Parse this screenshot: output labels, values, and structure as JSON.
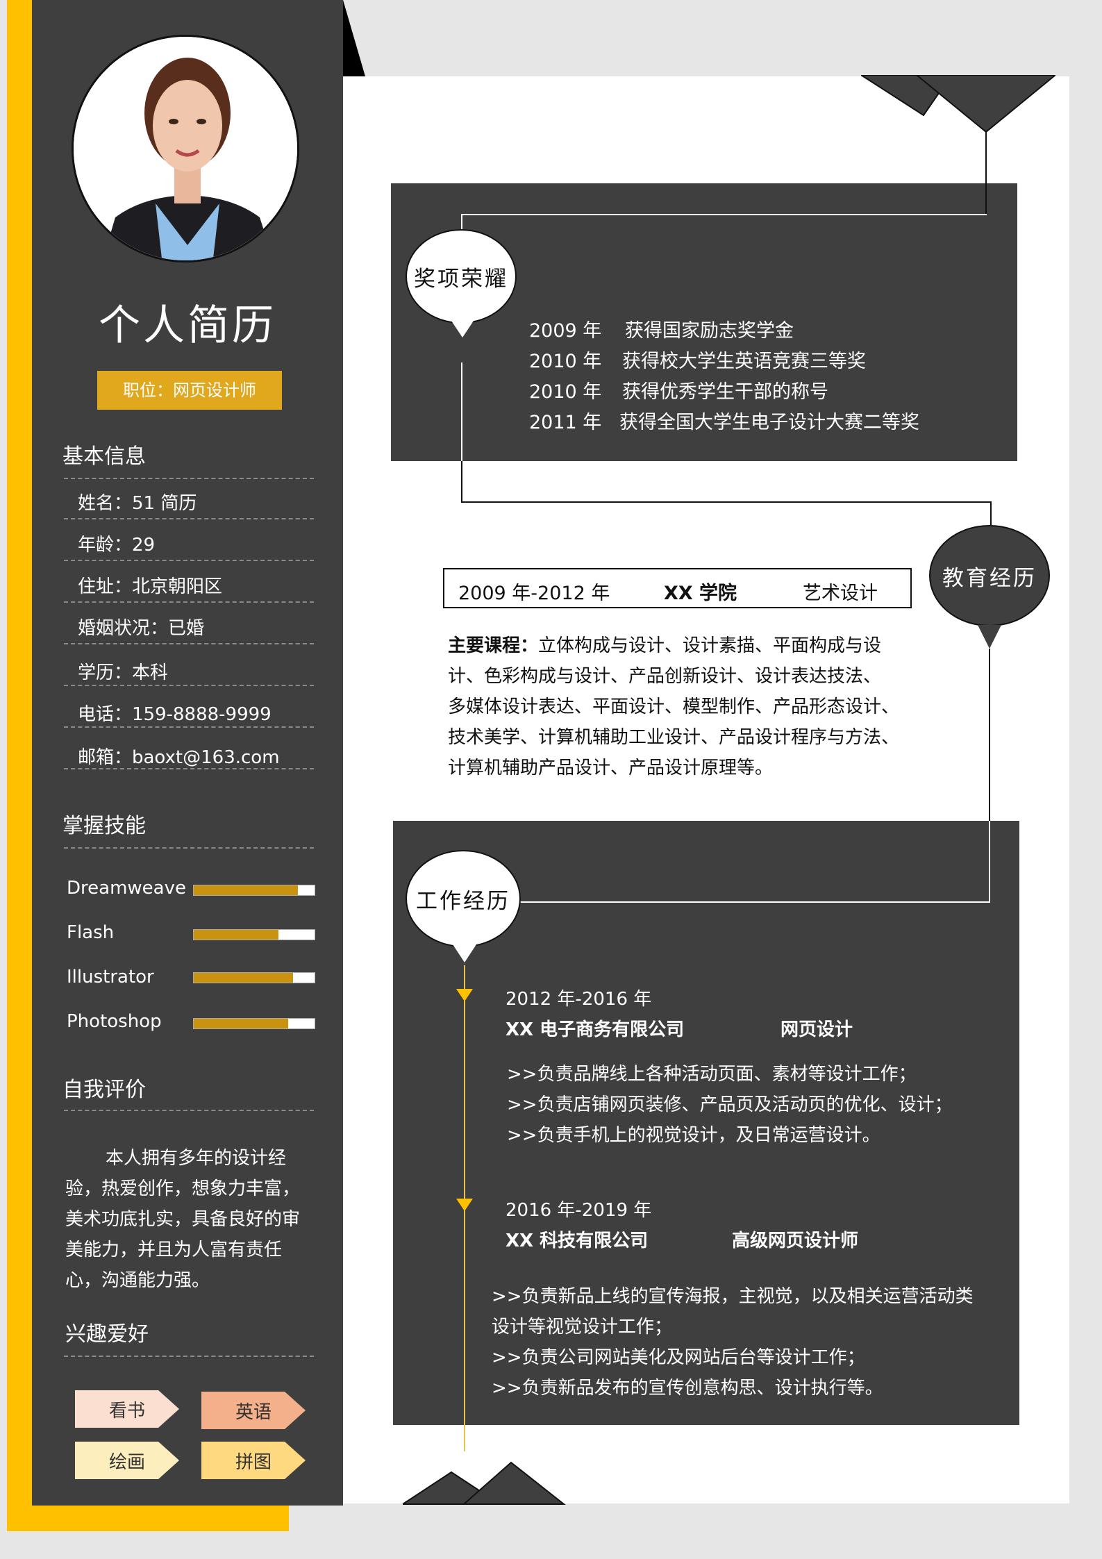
{
  "header": {
    "title": "个人简历",
    "position": "职位：网页设计师"
  },
  "basic_info": {
    "heading": "基本信息",
    "rows": [
      "姓名：51 简历",
      "年龄：29",
      "住址：北京朝阳区",
      "婚姻状况：已婚",
      "学历：本科",
      "电话：159-8888-9999",
      "邮箱：baoxt@163.com"
    ]
  },
  "skills": {
    "heading": "掌握技能",
    "items": [
      {
        "name": "Dreamweave",
        "level": 0.86
      },
      {
        "name": "Flash",
        "level": 0.7
      },
      {
        "name": "Illustrator",
        "level": 0.82
      },
      {
        "name": "Photoshop",
        "level": 0.78
      }
    ]
  },
  "self_evaluation": {
    "heading": "自我评价",
    "text": "本人拥有多年的设计经验，热爱创作，想象力丰富，美术功底扎实，具备良好的审美能力，并且为人富有责任心，沟通能力强。"
  },
  "hobbies": {
    "heading": "兴趣爱好",
    "items": [
      {
        "label": "看书",
        "color": "#fbe0d2"
      },
      {
        "label": "英语",
        "color": "#f4b08b"
      },
      {
        "label": "绘画",
        "color": "#fdeebe"
      },
      {
        "label": "拼图",
        "color": "#fed980"
      }
    ]
  },
  "awards": {
    "heading": "奖项荣耀",
    "items": [
      {
        "year": "2009 年",
        "text": "获得国家励志奖学金"
      },
      {
        "year": "2010 年",
        "text": "获得校大学生英语竞赛三等奖"
      },
      {
        "year": "2010 年",
        "text": "获得优秀学生干部的称号"
      },
      {
        "year": "2011 年",
        "text": "获得全国大学生电子设计大赛二等奖"
      }
    ]
  },
  "education": {
    "heading": "教育经历",
    "period": "2009 年-2012 年",
    "school": "XX 学院",
    "major": "艺术设计",
    "courses_label": "主要课程：",
    "courses_lines": [
      "立体构成与设计、设计素描、平面构成与设",
      "计、色彩构成与设计、产品创新设计、设计表达技法、",
      "多媒体设计表达、平面设计、模型制作、产品形态设计、",
      "技术美学、计算机辅助工业设计、产品设计程序与方法、",
      "计算机辅助产品设计、产品设计原理等。"
    ]
  },
  "work": {
    "heading": "工作经历",
    "jobs": [
      {
        "period": "2012 年-2016 年",
        "company": "XX 电子商务有限公司",
        "role": "网页设计",
        "duties": [
          ">>负责品牌线上各种活动页面、素材等设计工作；",
          ">>负责店铺网页装修、产品页及活动页的优化、设计；",
          ">>负责手机上的视觉设计，及日常运营设计。"
        ]
      },
      {
        "period": "2016 年-2019 年",
        "company": "XX 科技有限公司",
        "role": "高级网页设计师",
        "duties": [
          ">>负责新品上线的宣传海报，主视觉，以及相关运营活动类",
          "设计等视觉设计工作；",
          ">>负责公司网站美化及网站后台等设计工作；",
          ">>负责新品发布的宣传创意构思、设计执行等。"
        ]
      }
    ]
  }
}
